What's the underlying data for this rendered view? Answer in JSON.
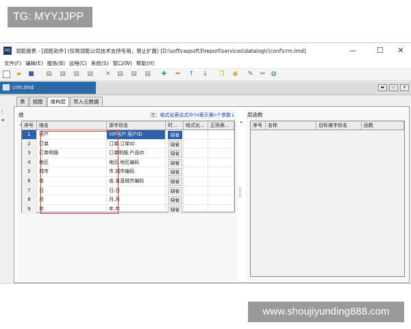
{
  "watermark_top": "TG: MYYJJPP",
  "watermark_bottom": "www.shoujiyunding888.com",
  "window": {
    "title": "润乾报表 - [润乾软件] (仅限润乾公司技术支持专用，禁止扩散)  [D:\\soft\\raqsoft3\\report\\services\\datalogic\\conf\\crm.lmd]",
    "logo_text": "DQ",
    "minimize": "—",
    "maximize": "☐",
    "close": "✕"
  },
  "menu": [
    "文件(F)",
    "编辑(E)",
    "服务(B)",
    "远程(C)",
    "系统(S)",
    "窗口(W)",
    "帮助(H)"
  ],
  "doc_tab": {
    "label": "crm.lmd"
  },
  "tabs": [
    "表",
    "视图",
    "维构层",
    "导入元数据"
  ],
  "active_tab": 2,
  "left_panel": {
    "title": "维",
    "note": "注：格式化表达式中?n表示第n个参数↓",
    "columns": [
      "序号",
      "维名",
      "源字段名",
      "时...",
      "格式化...",
      "正则表..."
    ],
    "rows": [
      {
        "idx": "1",
        "name": "客户",
        "src": "VIP客户.客户ID",
        "time": "缺省"
      },
      {
        "idx": "2",
        "name": "订单",
        "src": "订单.订单ID",
        "time": "缺省"
      },
      {
        "idx": "3",
        "name": "订单明细",
        "src": "订单明细.产品ID",
        "time": "缺省"
      },
      {
        "idx": "4",
        "name": "地区",
        "src": "地区.地区编码",
        "time": "缺省"
      },
      {
        "idx": "5",
        "name": "城市",
        "src": "市.城市编码",
        "time": "缺省"
      },
      {
        "idx": "6",
        "name": "省",
        "src": "省.省直辖市编码",
        "time": "缺省"
      },
      {
        "idx": "7",
        "name": "日",
        "src": "日.日",
        "time": "缺省"
      },
      {
        "idx": "8",
        "name": "月",
        "src": "月.月",
        "time": "缺省"
      },
      {
        "idx": "9",
        "name": "年",
        "src": "年.年",
        "time": "缺省"
      }
    ],
    "selected_row": 0
  },
  "right_panel": {
    "title": "层函数",
    "columns": [
      "序号",
      "名称",
      "目标维字段名",
      "函数"
    ]
  },
  "colors": {
    "selection": "#2d62a8",
    "highlight_box": "#d9323a",
    "note_text": "#1a3fb3",
    "doc_tab": "#2c6aa6"
  },
  "icons": {
    "toolbar": [
      "new-file-icon",
      "open-folder-icon",
      "save-icon",
      "table-icon",
      "table-icon",
      "table-icon",
      "table-icon",
      "delete-icon",
      "table-icon",
      "table-icon",
      "table-icon",
      "add-icon",
      "remove-icon",
      "move-up-icon",
      "move-down-icon",
      "copy-icon",
      "database-icon",
      "tools-icon",
      "globe-icon"
    ]
  }
}
